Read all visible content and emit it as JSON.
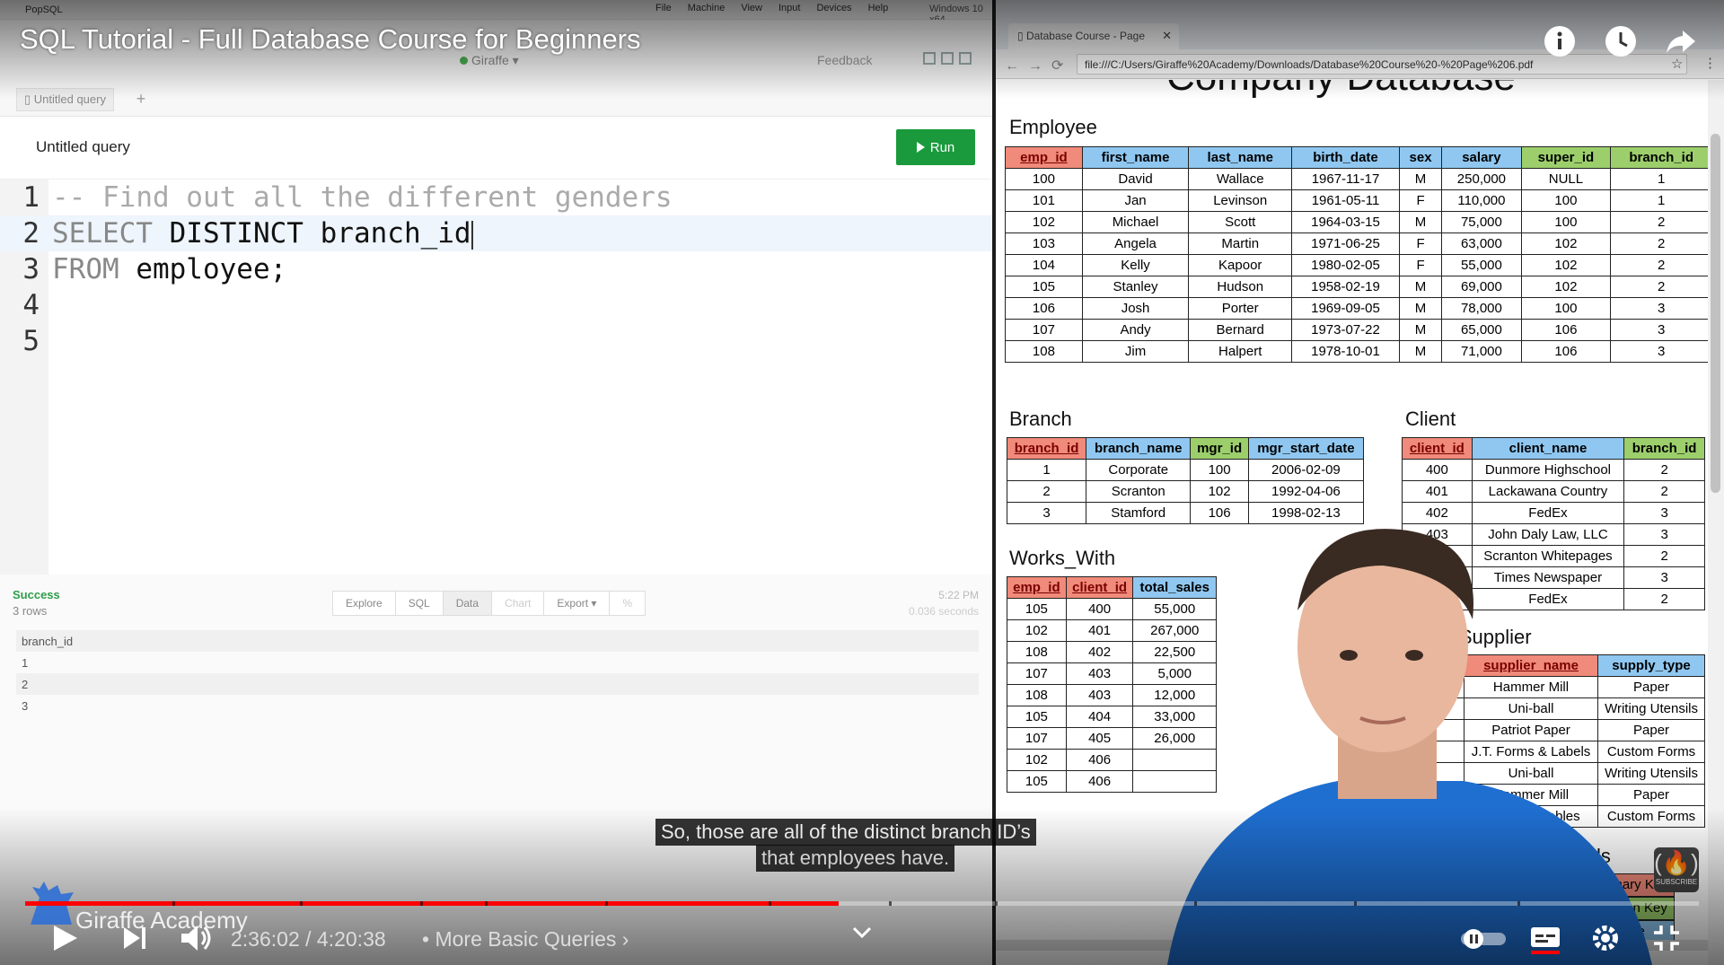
{
  "video": {
    "title": "SQL Tutorial - Full Database Course for Beginners",
    "time_current": "2:36:02",
    "time_total": "4:20:38",
    "time_separator": "/",
    "chapter": "More Basic Queries",
    "progress_fraction": 0.486,
    "watermark": "Giraffe Academy",
    "caption_line1": "So, those are all of the distinct branch ID’s",
    "caption_line2": "that employees have.",
    "subscribe_label": "SUBSCRIBE"
  },
  "vm": {
    "app_name": "PopSQL",
    "menus": [
      "File",
      "Machine",
      "View",
      "Input",
      "Devices",
      "Help"
    ],
    "window_label": "Windows 10 x64"
  },
  "popsql": {
    "workspace": "Giraffe",
    "feedback": "Feedback",
    "tab_label": "Untitled query",
    "query_title": "Untitled query",
    "run_label": "Run",
    "lines": [
      {
        "num": "1",
        "comment": "-- Find out all the different genders"
      },
      {
        "num": "2",
        "kw": "SELECT",
        "rest": " DISTINCT branch_id"
      },
      {
        "num": "3",
        "kw": "FROM",
        "rest": " employee;"
      },
      {
        "num": "4"
      },
      {
        "num": "5"
      }
    ],
    "result_status": "Success",
    "result_count": "3 rows",
    "result_tabs": [
      "Explore",
      "SQL",
      "Data",
      "Chart",
      "Export ▾",
      "%"
    ],
    "result_time": "5:22 PM",
    "result_duration": "0.036 seconds",
    "result_column": "branch_id",
    "result_rows": [
      "1",
      "2",
      "3"
    ]
  },
  "browser": {
    "tab_title": "Database Course - Page",
    "url": "file:///C:/Users/Giraffe%20Academy/Downloads/Database%20Course%20-%20Page%206.pdf",
    "pdf_title": "Company Database"
  },
  "tables": {
    "employee": {
      "title": "Employee",
      "headers": [
        "emp_id",
        "first_name",
        "last_name",
        "birth_date",
        "sex",
        "salary",
        "super_id",
        "branch_id"
      ],
      "rows": [
        [
          "100",
          "David",
          "Wallace",
          "1967-11-17",
          "M",
          "250,000",
          "NULL",
          "1"
        ],
        [
          "101",
          "Jan",
          "Levinson",
          "1961-05-11",
          "F",
          "110,000",
          "100",
          "1"
        ],
        [
          "102",
          "Michael",
          "Scott",
          "1964-03-15",
          "M",
          "75,000",
          "100",
          "2"
        ],
        [
          "103",
          "Angela",
          "Martin",
          "1971-06-25",
          "F",
          "63,000",
          "102",
          "2"
        ],
        [
          "104",
          "Kelly",
          "Kapoor",
          "1980-02-05",
          "F",
          "55,000",
          "102",
          "2"
        ],
        [
          "105",
          "Stanley",
          "Hudson",
          "1958-02-19",
          "M",
          "69,000",
          "102",
          "2"
        ],
        [
          "106",
          "Josh",
          "Porter",
          "1969-09-05",
          "M",
          "78,000",
          "100",
          "3"
        ],
        [
          "107",
          "Andy",
          "Bernard",
          "1973-07-22",
          "M",
          "65,000",
          "106",
          "3"
        ],
        [
          "108",
          "Jim",
          "Halpert",
          "1978-10-01",
          "M",
          "71,000",
          "106",
          "3"
        ]
      ]
    },
    "branch": {
      "title": "Branch",
      "headers": [
        "branch_id",
        "branch_name",
        "mgr_id",
        "mgr_start_date"
      ],
      "rows": [
        [
          "1",
          "Corporate",
          "100",
          "2006-02-09"
        ],
        [
          "2",
          "Scranton",
          "102",
          "1992-04-06"
        ],
        [
          "3",
          "Stamford",
          "106",
          "1998-02-13"
        ]
      ]
    },
    "client": {
      "title": "Client",
      "headers": [
        "client_id",
        "client_name",
        "branch_id"
      ],
      "rows": [
        [
          "400",
          "Dunmore Highschool",
          "2"
        ],
        [
          "401",
          "Lackawana Country",
          "2"
        ],
        [
          "402",
          "FedEx",
          "3"
        ],
        [
          "403",
          "John Daly Law, LLC",
          "3"
        ],
        [
          "404",
          "Scranton Whitepages",
          "2"
        ],
        [
          "405",
          "Times Newspaper",
          "3"
        ],
        [
          "406",
          "FedEx",
          "2"
        ]
      ]
    },
    "works_with": {
      "title": "Works_With",
      "headers": [
        "emp_id",
        "client_id",
        "total_sales"
      ],
      "rows": [
        [
          "105",
          "400",
          "55,000"
        ],
        [
          "102",
          "401",
          "267,000"
        ],
        [
          "108",
          "402",
          "22,500"
        ],
        [
          "107",
          "403",
          "5,000"
        ],
        [
          "108",
          "403",
          "12,000"
        ],
        [
          "105",
          "404",
          "33,000"
        ],
        [
          "107",
          "405",
          "26,000"
        ],
        [
          "102",
          "406",
          ""
        ],
        [
          "105",
          "406",
          ""
        ]
      ]
    },
    "branch_supplier": {
      "title": "Branch Supplier",
      "headers": [
        "branch_id",
        "supplier_name",
        "supply_type"
      ],
      "rows": [
        [
          "2",
          "Hammer Mill",
          "Paper"
        ],
        [
          "2",
          "Uni-ball",
          "Writing Utensils"
        ],
        [
          "",
          "Patriot Paper",
          "Paper"
        ],
        [
          "",
          "J.T. Forms & Labels",
          "Custom Forms"
        ],
        [
          "",
          "Uni-ball",
          "Writing Utensils"
        ],
        [
          "",
          "Hammer Mill",
          "Paper"
        ],
        [
          "",
          "Stamford Lables",
          "Custom Forms"
        ]
      ]
    },
    "labels": {
      "title": "Labels",
      "items": [
        "Primary Key",
        "Foreign Key",
        "Attribute"
      ]
    }
  }
}
